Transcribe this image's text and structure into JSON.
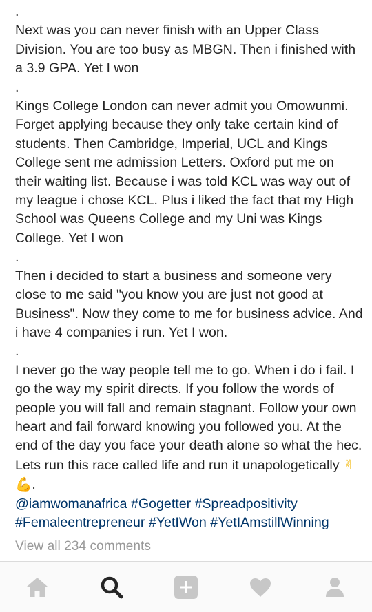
{
  "caption": {
    "dot1": ".",
    "para1": "Next was you can never finish with an Upper Class Division. You are too busy as MBGN. Then i finished with a 3.9 GPA. Yet I won",
    "dot2": ".",
    "para2": "Kings College London can never admit you Omowunmi. Forget applying because they only take certain kind of students. Then Cambridge, Imperial, UCL and Kings College sent me admission Letters. Oxford put me on their waiting list. Because i was told KCL was way out of my league i chose KCL. Plus i liked the fact that my High School was Queens College and my Uni was Kings College. Yet I won",
    "dot3": ".",
    "para3": "Then i decided to start a business and someone very close to me said \"you know you are just not good at Business\". Now they come to me for business advice. And i have 4 companies i run. Yet I won.",
    "dot4": ".",
    "para4": "I never go the way people tell me to go. When i do i fail. I go the way my spirit directs. If you follow the words of people you will fall and remain stagnant. Follow your own heart and fail forward knowing you followed you. At the end of the day you face your death alone so what the hec. Lets run this race called life and run it unapologetically",
    "emoji_victory": "✌",
    "emoji_flex": "💪",
    "para4_end": ".",
    "hashtags": [
      "@iamwomanafrica",
      "#Gogetter",
      "#Spreadpositivity",
      "#Femaleentrepreneur",
      "#YetIWon",
      "#YetIAmstillWinning"
    ]
  },
  "comments": {
    "view_all": "View all 234 comments"
  },
  "tabbar": {
    "items": [
      {
        "icon": "home-icon",
        "active": false
      },
      {
        "icon": "search-icon",
        "active": true
      },
      {
        "icon": "add-post-icon",
        "active": false
      },
      {
        "icon": "heart-icon",
        "active": false
      },
      {
        "icon": "profile-icon",
        "active": false
      }
    ],
    "inactive_color": "#c7c7c7",
    "active_color": "#262626"
  }
}
